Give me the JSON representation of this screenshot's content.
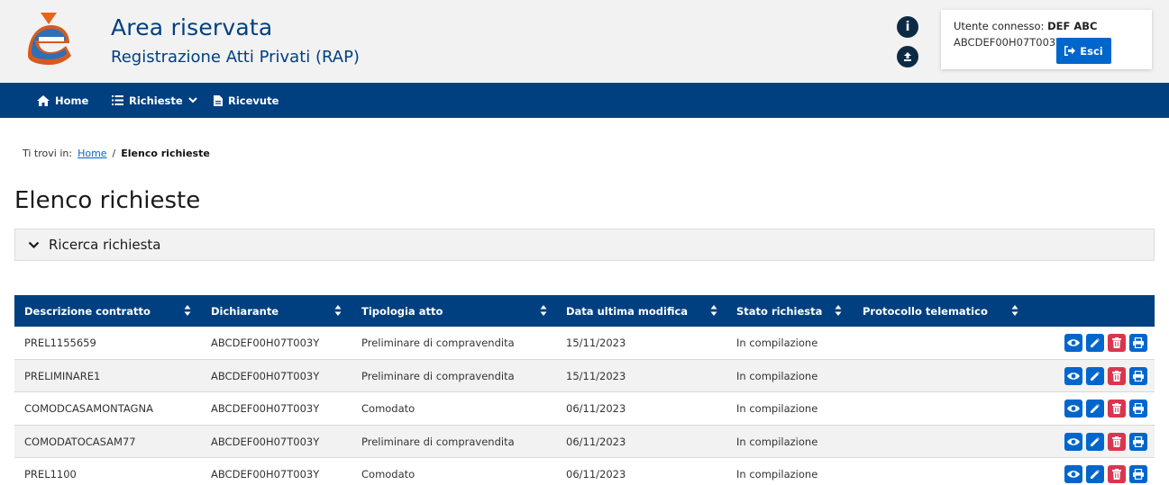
{
  "header": {
    "title": "Area riservata",
    "subtitle": "Registrazione Atti Privati (RAP)",
    "info_icon": "info-icon",
    "upload_icon": "upload-icon"
  },
  "user": {
    "connected_label": "Utente connesso:",
    "name": "DEF ABC",
    "code": "ABCDEF00H07T003Y",
    "logout_label": "Esci"
  },
  "nav": {
    "home": "Home",
    "requests": "Richieste",
    "receipts": "Ricevute"
  },
  "breadcrumb": {
    "prefix": "Ti trovi in:",
    "home": "Home",
    "separator": "/",
    "current": "Elenco richieste"
  },
  "page": {
    "title": "Elenco richieste",
    "search_panel": "Ricerca richiesta"
  },
  "table": {
    "columns": [
      "Descrizione contratto",
      "Dichiarante",
      "Tipologia atto",
      "Data ultima modifica",
      "Stato richiesta",
      "Protocollo telematico"
    ],
    "rows": [
      [
        "PREL1155659",
        "ABCDEF00H07T003Y",
        "Preliminare di compravendita",
        "15/11/2023",
        "In compilazione",
        ""
      ],
      [
        "PRELIMINARE1",
        "ABCDEF00H07T003Y",
        "Preliminare di compravendita",
        "15/11/2023",
        "In compilazione",
        ""
      ],
      [
        "COMODCASAMONTAGNA",
        "ABCDEF00H07T003Y",
        "Comodato",
        "06/11/2023",
        "In compilazione",
        ""
      ],
      [
        "COMODATOCASAM77",
        "ABCDEF00H07T003Y",
        "Preliminare di compravendita",
        "06/11/2023",
        "In compilazione",
        ""
      ],
      [
        "PREL1100",
        "ABCDEF00H07T003Y",
        "Comodato",
        "06/11/2023",
        "In compilazione",
        ""
      ]
    ],
    "row_actions": [
      "view-icon",
      "edit-icon",
      "delete-icon",
      "print-icon"
    ]
  },
  "colors": {
    "primary": "#004080",
    "accent": "#0066cc",
    "danger": "#d9364f",
    "header_bg": "#f2f2f2"
  }
}
